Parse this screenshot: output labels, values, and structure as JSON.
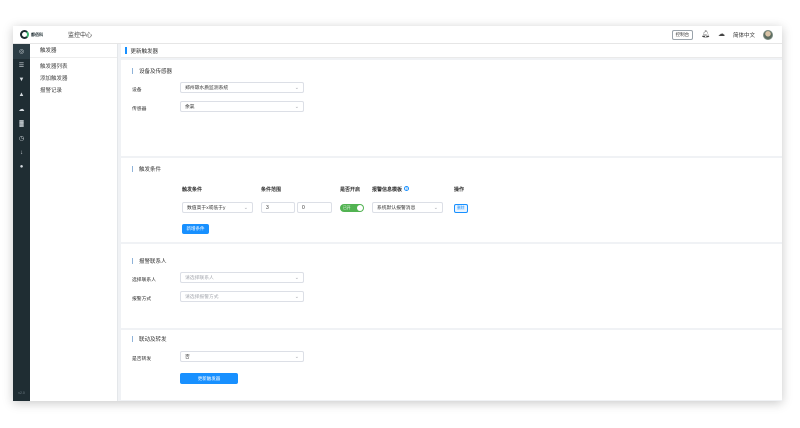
{
  "header": {
    "logo_text": "都佰科",
    "title": "监控中心",
    "console_button": "控制台",
    "language": "简体中文",
    "icons": [
      "bell-icon",
      "cloud-icon",
      "avatar"
    ]
  },
  "rail": {
    "icons": [
      "dashboard-icon",
      "list-icon",
      "location-icon",
      "alarm-icon",
      "cloud-icon",
      "chart-icon",
      "clock-icon",
      "download-icon",
      "user-icon"
    ],
    "version": "v2.0"
  },
  "submenu": {
    "title": "触发器",
    "items": [
      "触发器列表",
      "添加触发器",
      "报警记录"
    ]
  },
  "page": {
    "title": "更新触发器"
  },
  "device_section": {
    "title": "设备及传感器",
    "device_label": "设备",
    "device_value": "郑州碳水质监测系统",
    "sensor_label": "传感器",
    "sensor_value": "余氯"
  },
  "trigger_section": {
    "title": "触发条件",
    "columns": {
      "condition": "触发条件",
      "range": "条件范围",
      "enabled": "是否开启",
      "template": "报警信息模板",
      "action": "操作"
    },
    "row": {
      "condition": "数值高于x或低于y",
      "range_x": "3",
      "range_y": "0",
      "enabled_text": "已开",
      "template": "系统默认报警消息",
      "delete_button": "删除"
    },
    "add_button": "新增条件"
  },
  "contact_section": {
    "title": "报警联系人",
    "contact_label": "选择联系人",
    "contact_placeholder": "请选择联系人",
    "method_label": "报警方式",
    "method_placeholder": "请选择报警方式"
  },
  "linkage_section": {
    "title": "联动及转发",
    "forward_label": "是否转发",
    "forward_value": "否"
  },
  "submit_button": "更新触发器",
  "colors": {
    "primary": "#1890ff",
    "rail": "#1f2d33",
    "toggle_on": "#52b352"
  }
}
